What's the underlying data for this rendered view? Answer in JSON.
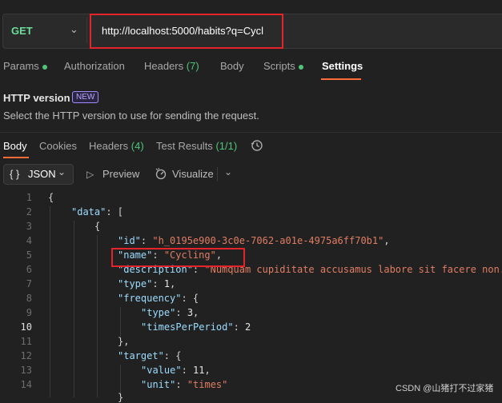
{
  "request": {
    "method": "GET",
    "url": "http://localhost:5000/habits?q=Cycl"
  },
  "request_tabs": [
    {
      "label": "Params",
      "dot": true
    },
    {
      "label": "Authorization"
    },
    {
      "label": "Headers",
      "count": "(7)"
    },
    {
      "label": "Body"
    },
    {
      "label": "Scripts",
      "dot": true
    },
    {
      "label": "Settings",
      "active": true
    }
  ],
  "settings": {
    "http_version_title": "HTTP version",
    "new_badge": "NEW",
    "http_version_desc": "Select the HTTP version to use for sending the request."
  },
  "response_tabs": [
    {
      "label": "Body",
      "active": true
    },
    {
      "label": "Cookies"
    },
    {
      "label": "Headers",
      "count": "(4)"
    },
    {
      "label": "Test Results",
      "count": "(1/1)"
    }
  ],
  "response_toolbar": {
    "format_icon": "{ }",
    "format_label": "JSON",
    "preview_label": "Preview",
    "visualize_label": "Visualize"
  },
  "code": {
    "current_line": 10,
    "line_numbers": [
      "1",
      "2",
      "3",
      "4",
      "5",
      "6",
      "7",
      "8",
      "9",
      "10",
      "11",
      "12",
      "13",
      "14"
    ],
    "data_key": "\"data\"",
    "id_key": "\"id\"",
    "id_value": "\"h_0195e900-3c0e-7062-a01e-4975a6ff70b1\"",
    "name_key": "\"name\"",
    "name_value": "\"Cycling\"",
    "description_key": "\"description\"",
    "description_value": "\"Numquam cupiditate accusamus labore sit facere non.",
    "type_key": "\"type\"",
    "type_value": "1",
    "frequency_key": "\"frequency\"",
    "freq_type_key": "\"type\"",
    "freq_type_value": "3",
    "times_key": "\"timesPerPeriod\"",
    "times_value": "2",
    "target_key": "\"target\"",
    "value_key": "\"value\"",
    "value_value": "11",
    "unit_key": "\"unit\"",
    "unit_value": "\"times\""
  },
  "watermark": "CSDN @山猪打不过家猪",
  "colors": {
    "background": "#212121",
    "method_green": "#6bdd9a",
    "accent_orange": "#ff6c37",
    "highlight_red": "#e5232b",
    "json_key": "#9cdcfe",
    "json_string": "#e07d63"
  }
}
